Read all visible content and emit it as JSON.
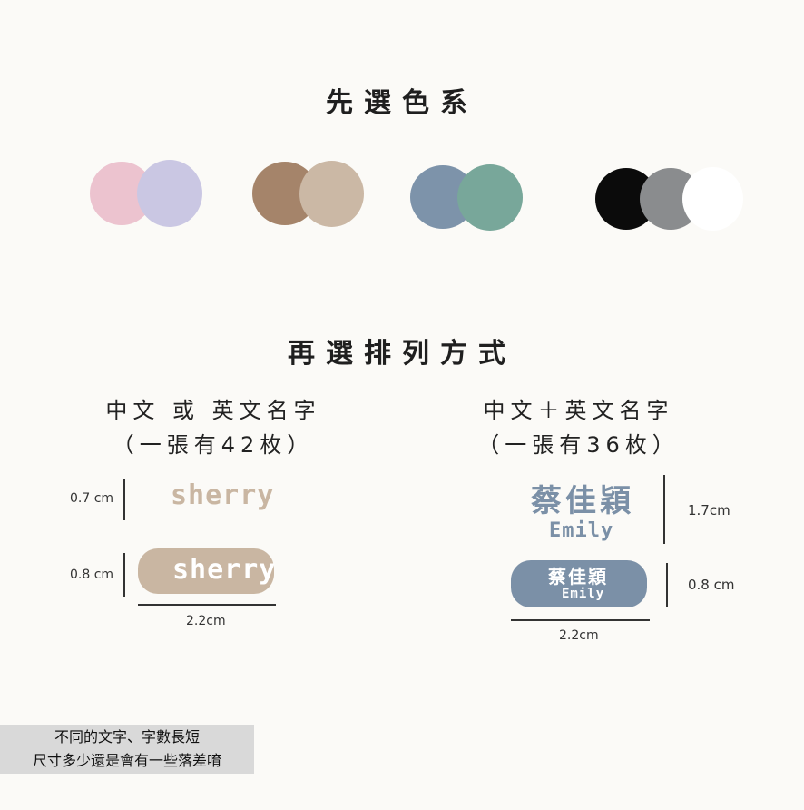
{
  "titles": {
    "colors": "先選色系",
    "layout": "再選排列方式"
  },
  "palettes": [
    {
      "name": "pink-lavender",
      "colors": [
        "#ecc3cf",
        "#cac7e3"
      ]
    },
    {
      "name": "brown-beige",
      "colors": [
        "#a5846a",
        "#cbb8a5"
      ]
    },
    {
      "name": "blue-green",
      "colors": [
        "#7d93aa",
        "#78a79a"
      ]
    },
    {
      "name": "black-grey-white",
      "colors": [
        "#0b0b0b",
        "#8a8c8e",
        "#ffffff"
      ]
    }
  ],
  "left": {
    "heading": "中文 或 英文名字",
    "sub": "（一張有42枚）",
    "sample_text": "sherry",
    "h1": "0.7 cm",
    "h2": "0.8 cm",
    "width": "2.2cm",
    "color": "#c9b6a2"
  },
  "right": {
    "heading": "中文＋英文名字",
    "sub": "（一張有36枚）",
    "cn_name": "蔡佳穎",
    "en_name": "Emily",
    "h1": "1.7cm",
    "h2": "0.8 cm",
    "width": "2.2cm",
    "color": "#7b90a7"
  },
  "note": {
    "line1": "不同的文字、字數長短",
    "line2": "尺寸多少還是會有一些落差唷"
  }
}
